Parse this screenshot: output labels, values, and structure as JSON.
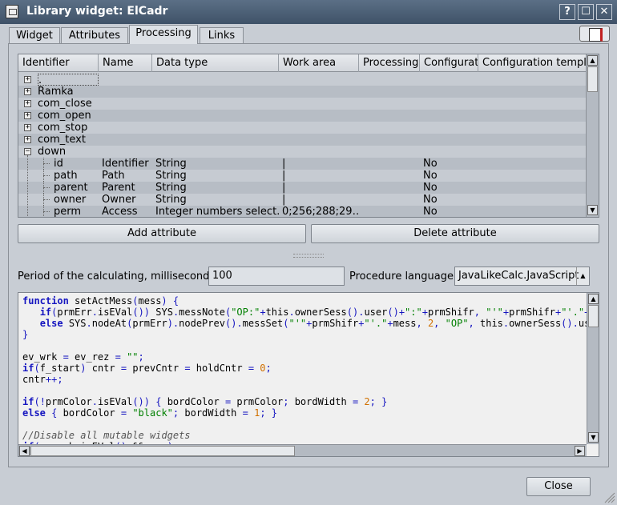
{
  "window": {
    "title": "Library widget: ElCadr"
  },
  "tabs": [
    {
      "label": "Widget"
    },
    {
      "label": "Attributes"
    },
    {
      "label": "Processing"
    },
    {
      "label": "Links"
    }
  ],
  "tree": {
    "columns": [
      "Identifier",
      "Name",
      "Data type",
      "Work area",
      "Processing",
      "Configurati",
      "Configuration templa"
    ],
    "rows": [
      {
        "id": ".",
        "name": "",
        "type": "",
        "work": "",
        "cfg": ""
      },
      {
        "id": "Ramka",
        "name": "",
        "type": "",
        "work": "",
        "cfg": ""
      },
      {
        "id": "com_close",
        "name": "",
        "type": "",
        "work": "",
        "cfg": ""
      },
      {
        "id": "com_open",
        "name": "",
        "type": "",
        "work": "",
        "cfg": ""
      },
      {
        "id": "com_stop",
        "name": "",
        "type": "",
        "work": "",
        "cfg": ""
      },
      {
        "id": "com_text",
        "name": "",
        "type": "",
        "work": "",
        "cfg": ""
      },
      {
        "id": "down",
        "name": "",
        "type": "",
        "work": "",
        "cfg": ""
      },
      {
        "id": "id",
        "name": "Identifier",
        "type": "String",
        "work": "|",
        "cfg": "No"
      },
      {
        "id": "path",
        "name": "Path",
        "type": "String",
        "work": "|",
        "cfg": "No"
      },
      {
        "id": "parent",
        "name": "Parent",
        "type": "String",
        "work": "|",
        "cfg": "No"
      },
      {
        "id": "owner",
        "name": "Owner",
        "type": "String",
        "work": "|",
        "cfg": "No"
      },
      {
        "id": "perm",
        "name": "Access",
        "type": "Integer numbers select…",
        "work": "0;256;288;29…",
        "cfg": "No"
      }
    ]
  },
  "buttons": {
    "add_attribute": "Add attribute",
    "delete_attribute": "Delete attribute",
    "close": "Close"
  },
  "period": {
    "label": "Period of the calculating, milliseconds:",
    "value": "100"
  },
  "language": {
    "label": "Procedure language:",
    "value": "JavaLikeCalc.JavaScript"
  },
  "code_lines": [
    "function setActMess(mess) {",
    "   if(prmErr.isEVal()) SYS.messNote(\"OP:\"+this.ownerSess().user()+\":\"+prmShifr, \"'\"+prmShifr+\"'.\"+mess",
    "   else SYS.nodeAt(prmErr).nodePrev().messSet(\"'\"+prmShifr+\"'.\"+mess, 2, \"OP\", this.ownerSess().us",
    "}",
    "",
    "ev_wrk = ev_rez = \"\";",
    "if(f_start) cntr = prevCntr = holdCntr = 0;",
    "cntr++;",
    "",
    "if(!prmColor.isEVal()) { bordColor = prmColor; bordWidth = 2; }",
    "else { bordColor = \"black\"; bordWidth = 1; }",
    "",
    "//Disable all mutable widgets",
    "if(ev_wrk.isEVal() && ...) ..."
  ],
  "colors": {
    "titlebar": "#4a5c72",
    "keyword": "#1515c0",
    "string": "#008000",
    "number": "#d07000",
    "comment": "#555555"
  },
  "icons": [
    "window-menu-icon",
    "help-icon",
    "maximize-icon",
    "close-icon",
    "library-book-icon"
  ]
}
